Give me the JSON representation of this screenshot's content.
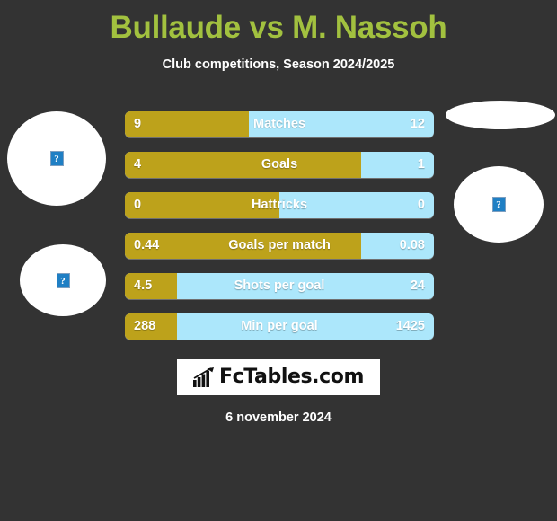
{
  "header": {
    "title": "Bullaude vs M. Nassoh",
    "subtitle": "Club competitions, Season 2024/2025",
    "title_color": "#a2c13f"
  },
  "colors": {
    "background": "#333333",
    "home_bar": "#bda21b",
    "away_bar": "#ace7fb",
    "text": "#ffffff"
  },
  "placeholders": [
    {
      "name": "home-player-photo",
      "alt": "?"
    },
    {
      "name": "home-club-logo",
      "alt": "?"
    },
    {
      "name": "away-player-photo",
      "alt": "?"
    },
    {
      "name": "away-club-logo",
      "alt": "?"
    }
  ],
  "chart_data": {
    "type": "bar",
    "title": "Bullaude vs M. Nassoh",
    "subtitle": "Club competitions, Season 2024/2025",
    "orientation": "horizontal-diverging",
    "categories": [
      "Matches",
      "Goals",
      "Hattricks",
      "Goals per match",
      "Shots per goal",
      "Min per goal"
    ],
    "series": [
      {
        "name": "Bullaude",
        "color": "#bda21b",
        "values": [
          "9",
          "4",
          "0",
          "0.44",
          "4.5",
          "288"
        ],
        "share_pct": [
          40,
          76.5,
          50,
          76.5,
          17,
          17
        ]
      },
      {
        "name": "M. Nassoh",
        "color": "#ace7fb",
        "values": [
          "12",
          "1",
          "0",
          "0.08",
          "24",
          "1425"
        ],
        "share_pct": [
          60,
          23.5,
          50,
          23.5,
          83,
          83
        ]
      }
    ],
    "grid": false,
    "legend": "none"
  },
  "rows": [
    {
      "label": "Matches",
      "left": "9",
      "right": "12",
      "fill_pct": 40
    },
    {
      "label": "Goals",
      "left": "4",
      "right": "1",
      "fill_pct": 76.5
    },
    {
      "label": "Hattricks",
      "left": "0",
      "right": "0",
      "fill_pct": 50
    },
    {
      "label": "Goals per match",
      "left": "0.44",
      "right": "0.08",
      "fill_pct": 76.5
    },
    {
      "label": "Shots per goal",
      "left": "4.5",
      "right": "24",
      "fill_pct": 17
    },
    {
      "label": "Min per goal",
      "left": "288",
      "right": "1425",
      "fill_pct": 17
    }
  ],
  "footer": {
    "logo_text": "FcTables.com",
    "logo_icon": "bar-chart-arrow-icon",
    "date": "6 november 2024"
  }
}
